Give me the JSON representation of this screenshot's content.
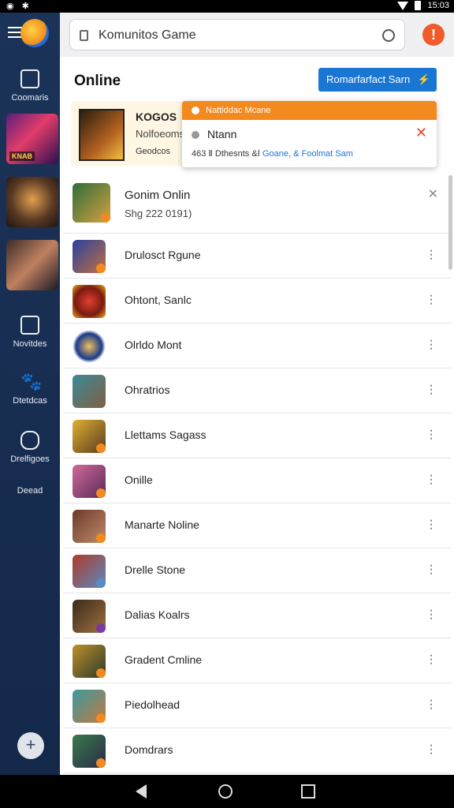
{
  "status_bar": {
    "time": "15:03"
  },
  "sidebar": {
    "items": [
      {
        "label": "Coomaris",
        "icon": "calculator-icon"
      },
      {
        "label": "Novitdes",
        "icon": "news-icon"
      },
      {
        "label": "Dtetdcas",
        "icon": "paw-icon"
      },
      {
        "label": "Drelfigoes",
        "icon": "chat-icon"
      },
      {
        "label": "Deead",
        "icon": ""
      }
    ],
    "thumbnail_label": "KNAB"
  },
  "search": {
    "value": "Komunitos Game",
    "placeholder": "Komunitos Game"
  },
  "main": {
    "title": "Online",
    "action_button": "Romarfarfact Sarn",
    "featured": {
      "title": "KOGOS",
      "subtitle": "Nolfoeoms",
      "meta": "Geodcos"
    },
    "popup": {
      "header": "Nattiddac Mcane",
      "name": "Ntann",
      "meta_prefix": "463 Ⅱ Dthesnts &Ⅰ",
      "meta_link1": "Goane, &",
      "meta_link2": "Foolmat Sam"
    }
  },
  "list": [
    {
      "name": "Gonim Onlin",
      "subtitle": "Shg 222 0191)"
    },
    {
      "name": "Drulosct Rgune"
    },
    {
      "name": "Ohtont, Sanlc"
    },
    {
      "name": "Olrldo Mont"
    },
    {
      "name": "Ohratrios"
    },
    {
      "name": "Llettams Sagass"
    },
    {
      "name": "Onille"
    },
    {
      "name": "Manarte Noline"
    },
    {
      "name": "Drelle Stone"
    },
    {
      "name": "Dalias Koalrs"
    },
    {
      "name": "Gradent Cmline"
    },
    {
      "name": "Piedolhead"
    },
    {
      "name": "Domdrars"
    }
  ],
  "colors": {
    "sidebar": "#1b3358",
    "accent": "#1976d2",
    "warning": "#f28a1f",
    "danger": "#ef5b2b"
  }
}
